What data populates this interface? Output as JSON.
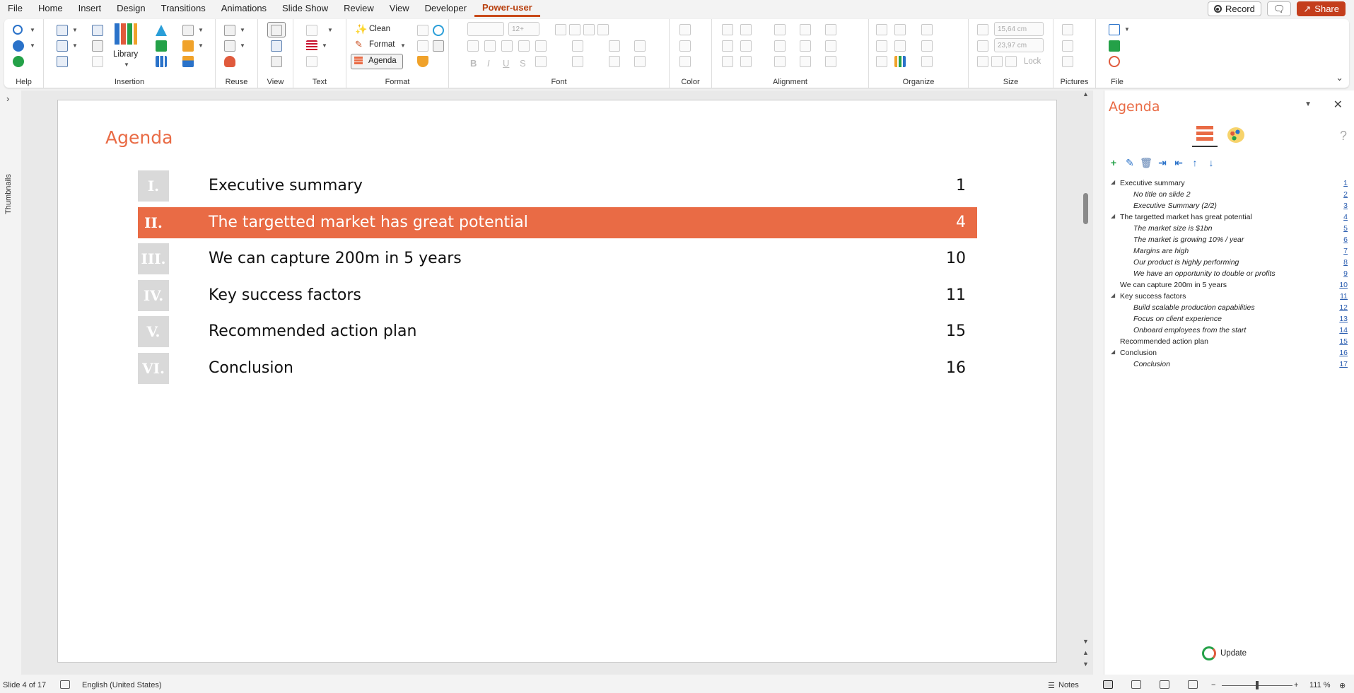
{
  "menubar": {
    "tabs": [
      "File",
      "Home",
      "Insert",
      "Design",
      "Transitions",
      "Animations",
      "Slide Show",
      "Review",
      "View",
      "Developer",
      "Power-user"
    ],
    "active_tab": "Power-user",
    "record_label": "Record",
    "share_label": "Share"
  },
  "ribbon": {
    "groups": {
      "help": "Help",
      "insertion": "Insertion",
      "reuse": "Reuse",
      "view": "View",
      "text": "Text",
      "format": "Format",
      "font": "Font",
      "color": "Color",
      "alignment": "Alignment",
      "organize": "Organize",
      "size": "Size",
      "pictures": "Pictures",
      "file": "File"
    },
    "library_label": "Library",
    "clean_label": "Clean",
    "format_label": "Format",
    "agenda_label": "Agenda",
    "font_size_placeholder": "12+",
    "width_value": "15,64 cm",
    "height_value": "23,97 cm",
    "lock_label": "Lock"
  },
  "thumbnails_label": "Thumbnails",
  "slide": {
    "title": "Agenda",
    "items": [
      {
        "num": "I.",
        "text": "Executive summary",
        "page": "1",
        "active": false
      },
      {
        "num": "II.",
        "text": "The targetted market has great potential",
        "page": "4",
        "active": true
      },
      {
        "num": "III.",
        "text": "We can capture 200m in 5 years",
        "page": "10",
        "active": false
      },
      {
        "num": "IV.",
        "text": "Key success factors",
        "page": "11",
        "active": false
      },
      {
        "num": "V.",
        "text": "Recommended action plan",
        "page": "15",
        "active": false
      },
      {
        "num": "VI.",
        "text": "Conclusion",
        "page": "16",
        "active": false
      }
    ]
  },
  "pane": {
    "title": "Agenda",
    "help": "?",
    "tree": [
      {
        "text": "Executive summary",
        "page": "1",
        "level": 0,
        "expand": true
      },
      {
        "text": "No title on slide 2",
        "page": "2",
        "level": 1
      },
      {
        "text": "Executive Summary (2/2)",
        "page": "3",
        "level": 1
      },
      {
        "text": "The targetted market has great potential",
        "page": "4",
        "level": 0,
        "expand": true
      },
      {
        "text": "The market size is $1bn",
        "page": "5",
        "level": 1
      },
      {
        "text": "The market is growing 10% / year",
        "page": "6",
        "level": 1
      },
      {
        "text": "Margins are high",
        "page": "7",
        "level": 1
      },
      {
        "text": "Our product is highly performing",
        "page": "8",
        "level": 1
      },
      {
        "text": "We have an opportunity to double or profits",
        "page": "9",
        "level": 1
      },
      {
        "text": "We can capture 200m in 5 years",
        "page": "10",
        "level": 0,
        "expand": false
      },
      {
        "text": "Key success factors",
        "page": "11",
        "level": 0,
        "expand": true
      },
      {
        "text": "Build scalable production capabilities",
        "page": "12",
        "level": 1
      },
      {
        "text": "Focus on client experience",
        "page": "13",
        "level": 1
      },
      {
        "text": "Onboard employees from the start",
        "page": "14",
        "level": 1
      },
      {
        "text": "Recommended action plan",
        "page": "15",
        "level": 0,
        "expand": false
      },
      {
        "text": "Conclusion",
        "page": "16",
        "level": 0,
        "expand": true
      },
      {
        "text": "Conclusion",
        "page": "17",
        "level": 1
      }
    ],
    "update_label": "Update"
  },
  "statusbar": {
    "slide_info": "Slide 4 of 17",
    "language": "English (United States)",
    "notes_label": "Notes",
    "zoom": "111 %"
  },
  "colors": {
    "accent": "#e96b45",
    "share": "#c43e1c",
    "link": "#2a5db0"
  }
}
